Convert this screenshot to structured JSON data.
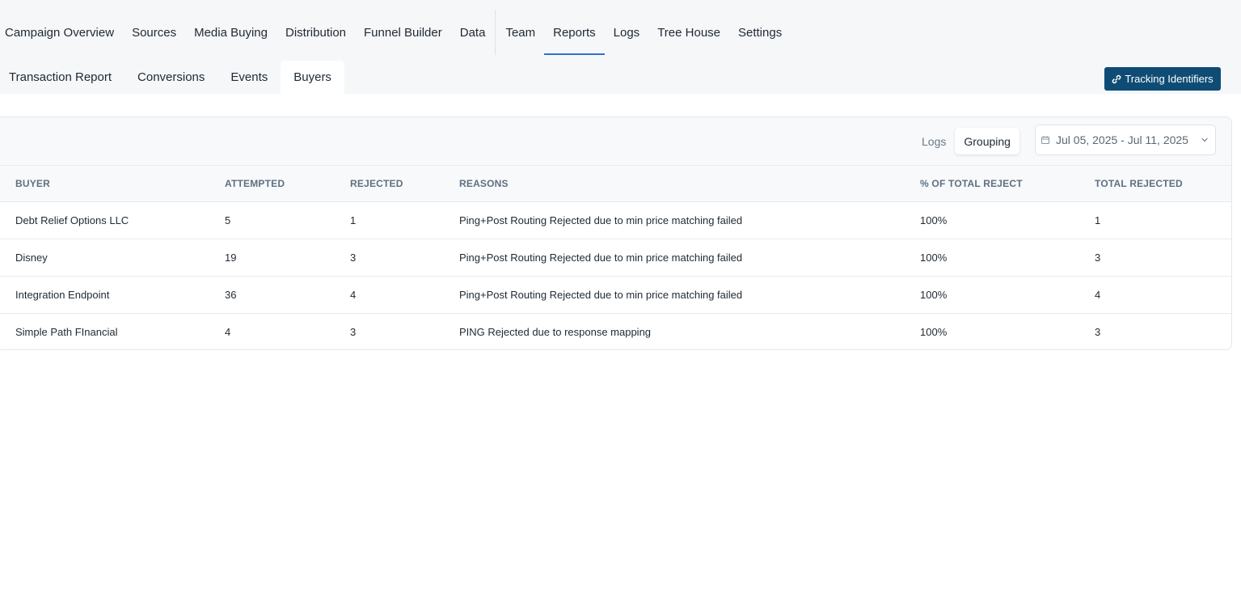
{
  "main_nav": {
    "items": [
      {
        "label": "Campaign Overview"
      },
      {
        "label": "Sources"
      },
      {
        "label": "Media Buying"
      },
      {
        "label": "Distribution"
      },
      {
        "label": "Funnel Builder"
      },
      {
        "label": "Data"
      },
      {
        "label": "Team"
      },
      {
        "label": "Reports",
        "active": true
      },
      {
        "label": "Logs"
      },
      {
        "label": "Tree House"
      },
      {
        "label": "Settings"
      }
    ]
  },
  "sub_nav": {
    "tabs": [
      {
        "label": "Transaction Report"
      },
      {
        "label": "Conversions"
      },
      {
        "label": "Events"
      },
      {
        "label": "Buyers",
        "active": true
      }
    ]
  },
  "tracking_button": {
    "label": "Tracking Identifiers",
    "icon": "link-icon",
    "color": "#0f4c75"
  },
  "view_toggle": {
    "logs_label": "Logs",
    "grouping_label": "Grouping",
    "selected": "Grouping"
  },
  "date_range": {
    "value": "Jul 05, 2025 - Jul 11, 2025",
    "icon": "calendar-icon"
  },
  "table": {
    "headers": [
      "BUYER",
      "ATTEMPTED",
      "REJECTED",
      "REASONS",
      "% OF TOTAL REJECT",
      "TOTAL REJECTED"
    ],
    "rows": [
      {
        "buyer": "Debt Relief Options LLC",
        "attempted": "5",
        "rejected": "1",
        "reasons": "Ping+Post Routing Rejected due to min price matching failed",
        "pct": "100%",
        "total": "1"
      },
      {
        "buyer": "Disney",
        "attempted": "19",
        "rejected": "3",
        "reasons": "Ping+Post Routing Rejected due to min price matching failed",
        "pct": "100%",
        "total": "3"
      },
      {
        "buyer": "Integration Endpoint",
        "attempted": "36",
        "rejected": "4",
        "reasons": "Ping+Post Routing Rejected due to min price matching failed",
        "pct": "100%",
        "total": "4"
      },
      {
        "buyer": "Simple Path FInancial",
        "attempted": "4",
        "rejected": "3",
        "reasons": "PING Rejected due to response mapping",
        "pct": "100%",
        "total": "3"
      }
    ]
  },
  "colors": {
    "accent": "#2d6fd8",
    "primary_button": "#0f4c75"
  }
}
